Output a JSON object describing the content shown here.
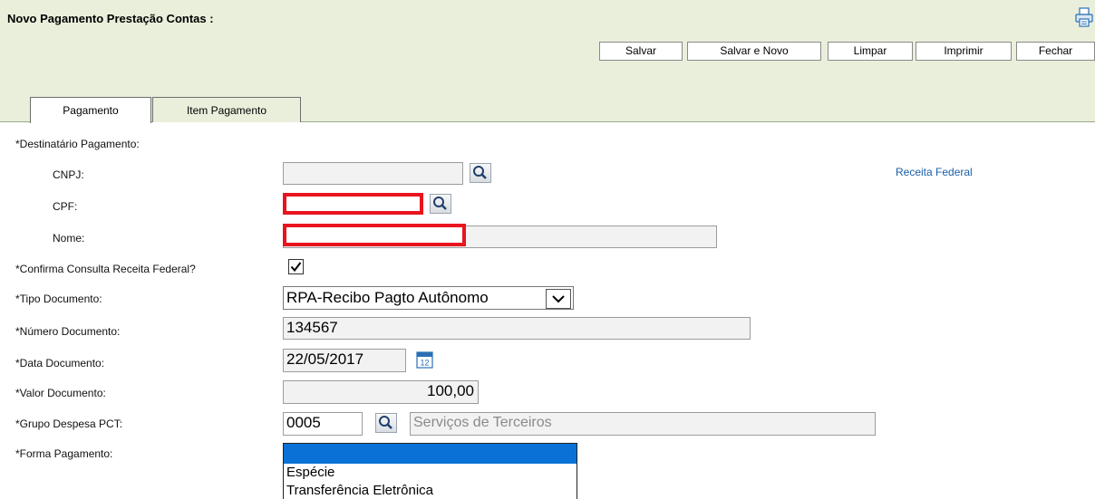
{
  "header": {
    "title": "Novo Pagamento Prestação Contas :",
    "print_icon": "printer-icon"
  },
  "toolbar": {
    "salvar": "Salvar",
    "salvar_novo": "Salvar e Novo",
    "limpar": "Limpar",
    "imprimir": "Imprimir",
    "fechar": "Fechar"
  },
  "tabs": [
    {
      "label": "Pagamento",
      "active": true
    },
    {
      "label": "Item Pagamento",
      "active": false
    }
  ],
  "form": {
    "destinatario_label": "*Destinatário Pagamento:",
    "cnpj_label": "CNPJ:",
    "cnpj_value": "",
    "cpf_label": "CPF:",
    "cpf_value": "",
    "nome_label": "Nome:",
    "nome_value": "",
    "receita_link": "Receita Federal",
    "confirma_label": "*Confirma Consulta Receita Federal?",
    "confirma_checked": true,
    "tipo_label": "*Tipo Documento:",
    "tipo_value": "RPA-Recibo Pagto Autônomo",
    "numero_label": "*Número Documento:",
    "numero_value": "134567",
    "data_label": "*Data Documento:",
    "data_value": "22/05/2017",
    "valor_label": "*Valor Documento:",
    "valor_value": "100,00",
    "grupo_label": "*Grupo Despesa PCT:",
    "grupo_code": "0005",
    "grupo_desc": "Serviços de Terceiros",
    "forma_label": "*Forma Pagamento:",
    "forma_options": [
      "",
      "Espécie",
      "Transferência Eletrônica"
    ]
  },
  "colors": {
    "band": "#e9efdb",
    "link": "#1a5fa8",
    "redaction": "#e8141e",
    "selection": "#0a72d6"
  },
  "icons": {
    "lookup": "magnifier-icon",
    "calendar": "calendar-icon",
    "checkmark": "checkmark-icon",
    "dropdown": "chevron-down-icon"
  }
}
